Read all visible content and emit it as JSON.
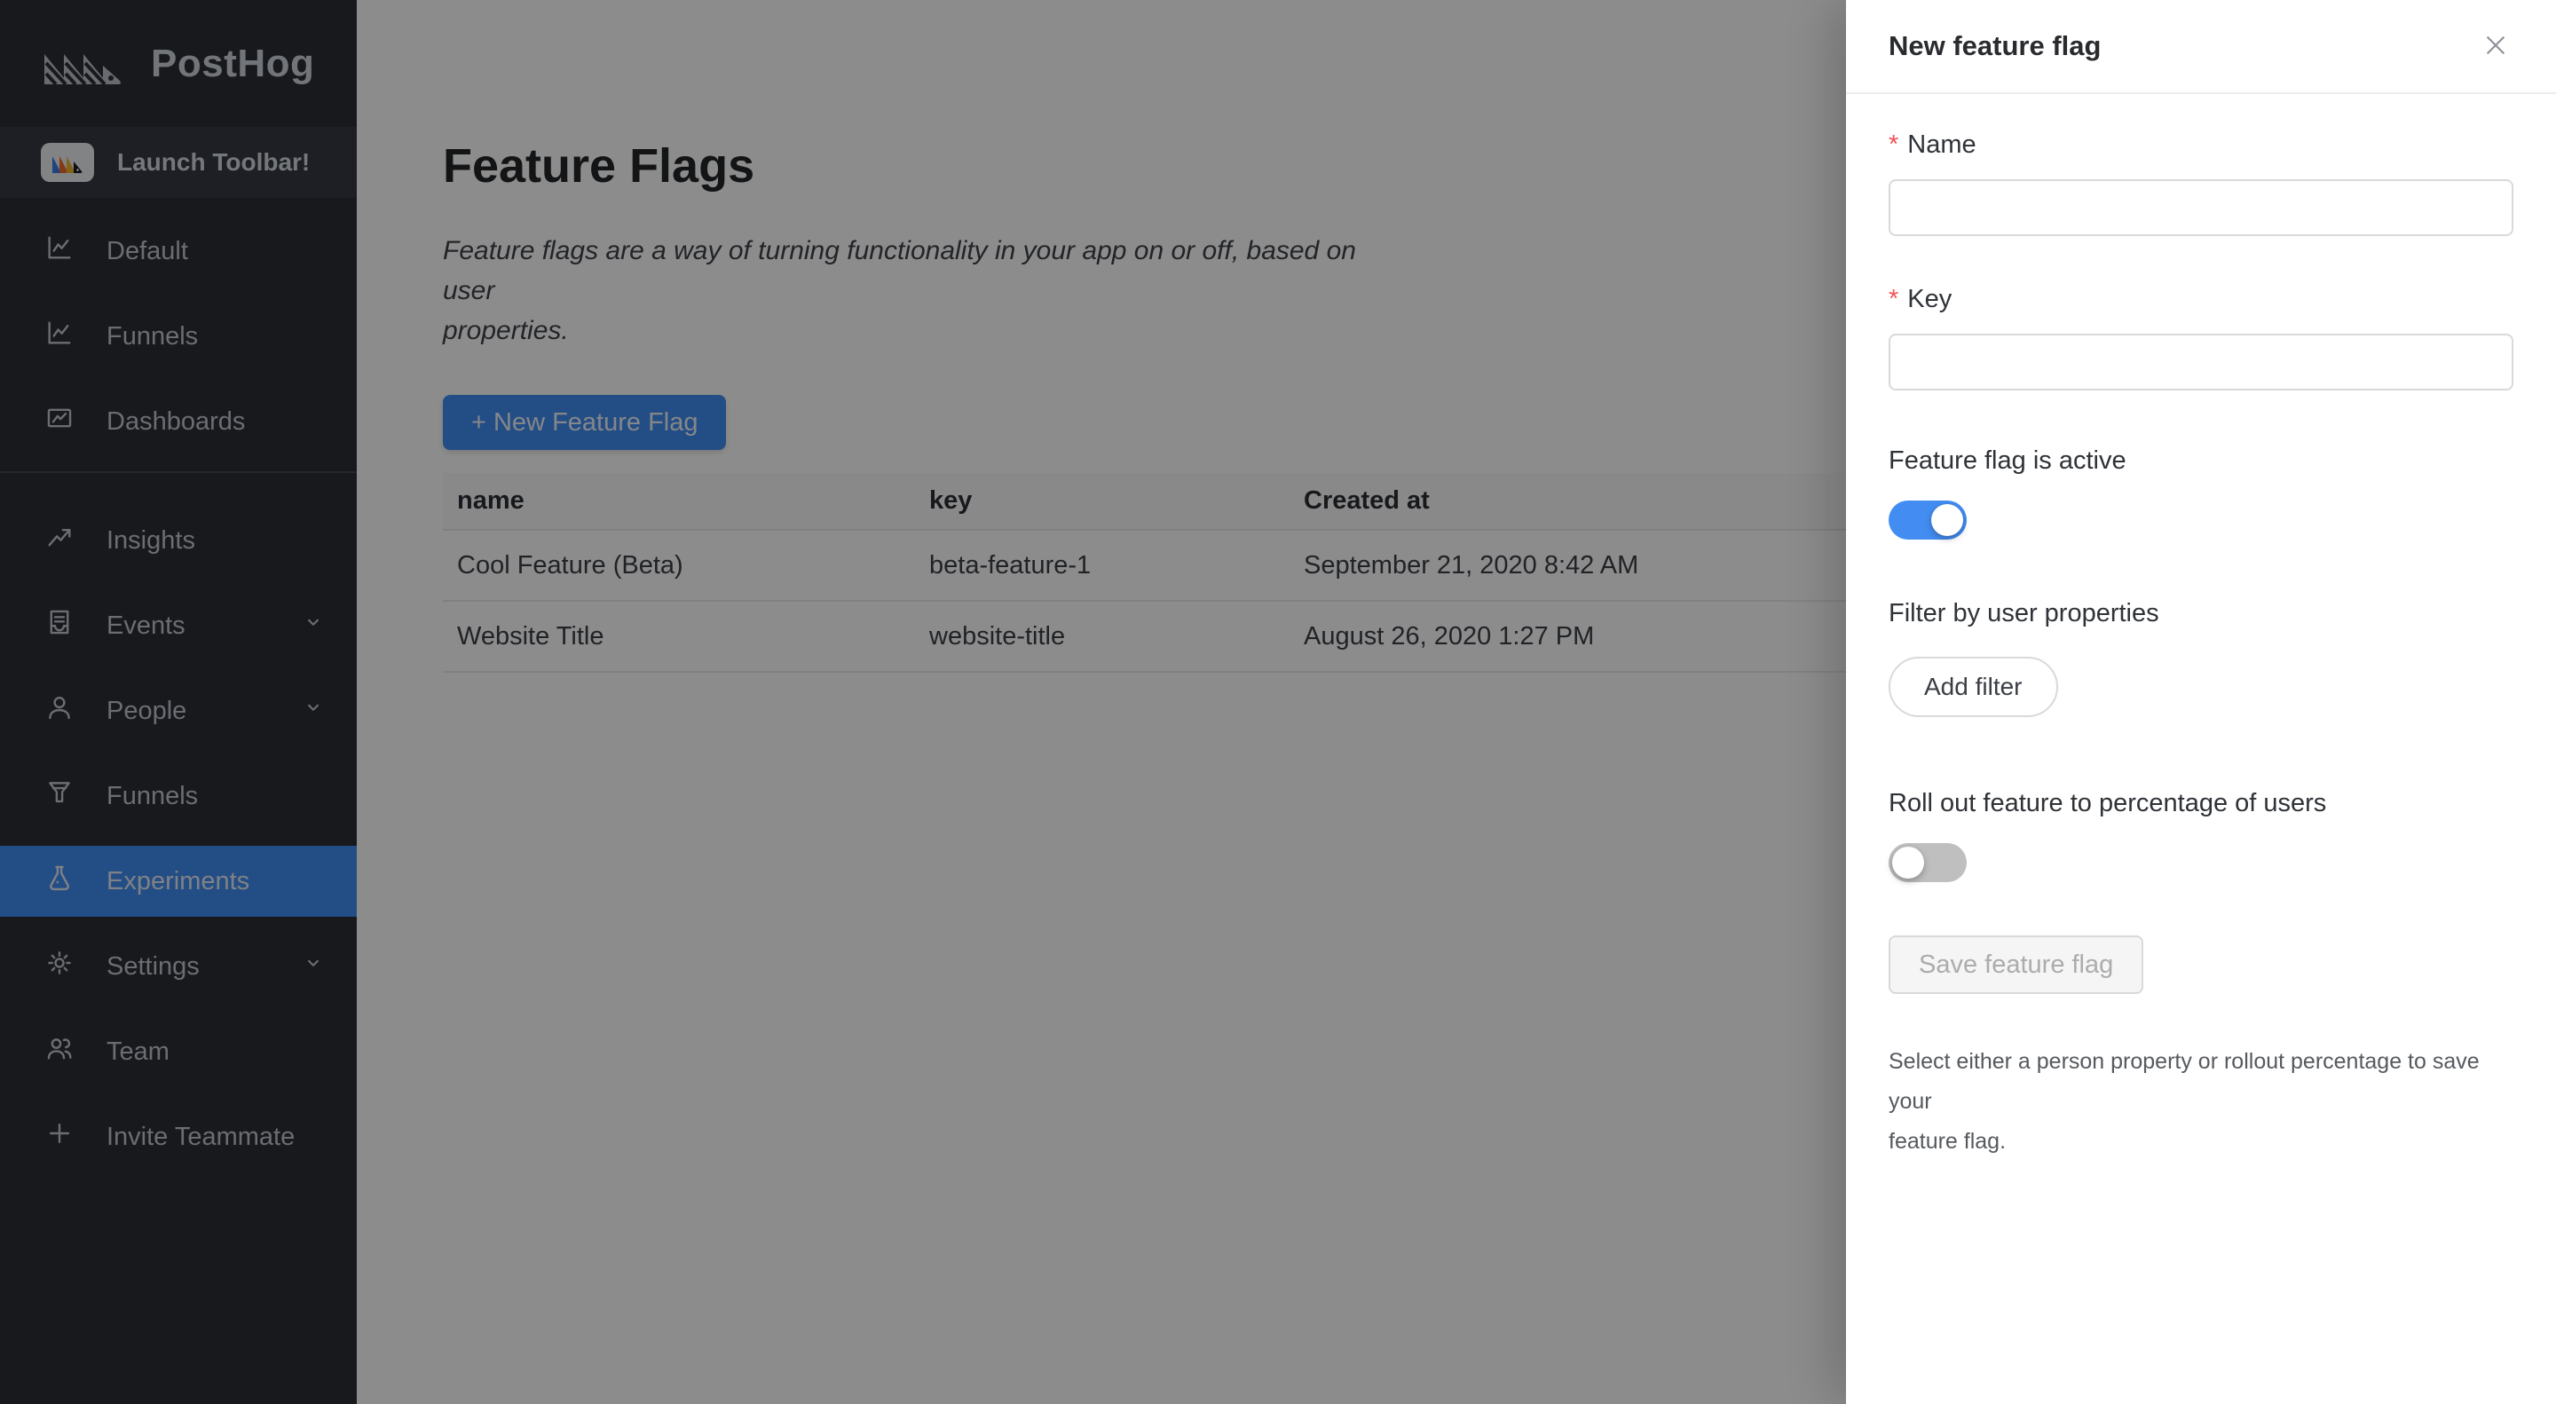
{
  "sidebar": {
    "logo_text": "PostHog",
    "launch_toolbar_label": "Launch Toolbar!",
    "groups": [
      {
        "items": [
          {
            "label": "Default",
            "icon": "line-chart"
          },
          {
            "label": "Funnels",
            "icon": "line-chart"
          },
          {
            "label": "Dashboards",
            "icon": "fund-chart"
          }
        ]
      },
      {
        "items": [
          {
            "label": "Insights",
            "icon": "rise-arrow"
          },
          {
            "label": "Events",
            "icon": "container",
            "has_submenu": true
          },
          {
            "label": "People",
            "icon": "user",
            "has_submenu": true
          },
          {
            "label": "Funnels",
            "icon": "funnel"
          },
          {
            "label": "Experiments",
            "icon": "experiment-flask",
            "active": true
          },
          {
            "label": "Settings",
            "icon": "gear",
            "has_submenu": true
          },
          {
            "label": "Team",
            "icon": "team"
          },
          {
            "label": "Invite Teammate",
            "icon": "plus"
          }
        ]
      }
    ]
  },
  "main": {
    "title": "Feature Flags",
    "description_lines": [
      "Feature flags are a way of turning functionality in your app on or off, based on user",
      "properties."
    ],
    "new_flag_button_label": "+ New Feature Flag",
    "table": {
      "columns": [
        "name",
        "key",
        "Created at"
      ],
      "rows": [
        {
          "name": "Cool Feature (Beta)",
          "key": "beta-feature-1",
          "created_at": "September 21, 2020 8:42 AM"
        },
        {
          "name": "Website Title",
          "key": "website-title",
          "created_at": "August 26, 2020 1:27 PM"
        }
      ]
    }
  },
  "drawer": {
    "title": "New feature flag",
    "required_mark": "*",
    "name_label": "Name",
    "key_label": "Key",
    "active_toggle": {
      "label": "Feature flag is active",
      "state": "on"
    },
    "filter_section": {
      "label": "Filter by user properties",
      "add_filter_button_label": "Add filter"
    },
    "rollout_toggle": {
      "label": "Roll out feature to percentage of users",
      "state": "off"
    },
    "save_button_label": "Save feature flag",
    "hint_lines": [
      "Select either a person property or rollout percentage to save your",
      "feature flag."
    ]
  },
  "colors": {
    "primary_blue": "#418df2",
    "switch_off_gray": "#bfbfbf",
    "required_red": "#f25355",
    "sidebar_bg": "#2b2e35",
    "sidebar_active_bg": "#418df2",
    "launch_row_bg": "#353942",
    "mask": "rgba(0,0,0,0.45)",
    "table_header_bg": "#fafafa",
    "drawer_bg": "#ffffff"
  }
}
